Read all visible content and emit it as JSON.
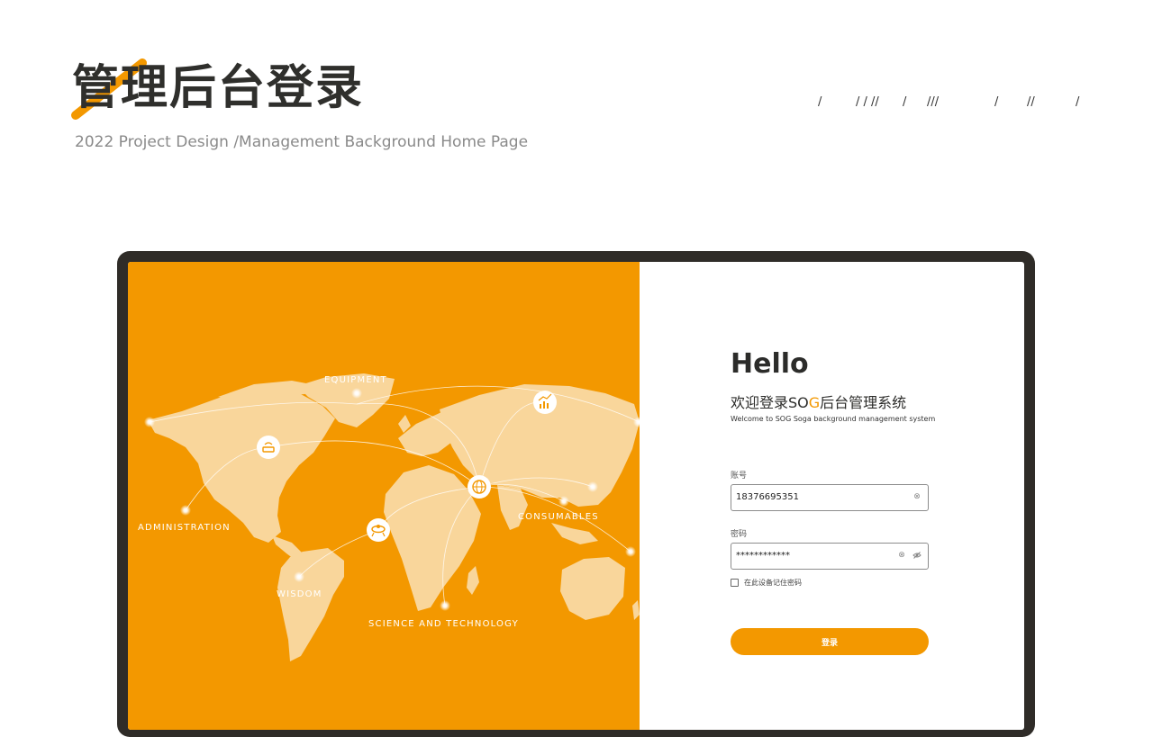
{
  "header": {
    "title": "管理后台登录",
    "subtitle": "2022 Project Design  /Management Background Home Page",
    "slash_marks": [
      "/",
      "/ / //",
      "/",
      "///",
      "/",
      "//",
      "/"
    ]
  },
  "map": {
    "labels": {
      "equipment": "EQUIPMENT",
      "administration": "ADMINISTRATION",
      "consumables": "CONSUMABLES",
      "wisdom": "WISDOM",
      "science": "SCIENCE AND TECHNOLOGY"
    },
    "icons": {
      "administration": "router-icon",
      "hub": "globe-icon",
      "chart": "bar-chart-icon",
      "science": "satellite-icon"
    }
  },
  "login": {
    "greeting": "Hello",
    "welcome_cn_prefix": "欢迎登录SO",
    "welcome_cn_highlight": "G",
    "welcome_cn_suffix": "后台管理系统",
    "welcome_en": "Welcome to SOG Soga background management system",
    "account_label": "账号",
    "account_value": "18376695351",
    "password_label": "密码",
    "password_value": "************",
    "remember_label": "在此设备记住密码",
    "submit_label": "登录"
  },
  "colors": {
    "accent": "#f39800",
    "dark": "#2f2c28",
    "land": "#f9d69b"
  }
}
